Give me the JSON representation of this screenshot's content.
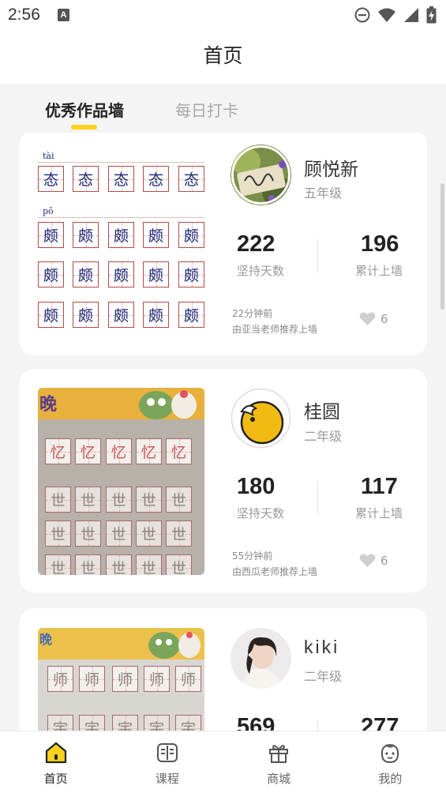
{
  "status_bar": {
    "time": "2:56",
    "notification_icon": "text-a-icon",
    "icons": [
      "dnd-icon",
      "wifi-icon",
      "cell-signal-icon",
      "battery-charging-icon"
    ]
  },
  "header": {
    "title": "首页"
  },
  "tabs": [
    {
      "label": "优秀作品墙",
      "active": true
    },
    {
      "label": "每日打卡",
      "active": false
    }
  ],
  "accent_color": "#ffd21e",
  "cards": [
    {
      "name": "顾悦新",
      "grade": "五年级",
      "stat1": {
        "value": "222",
        "label": "坚持天数"
      },
      "stat2": {
        "value": "196",
        "label": "累计上墙"
      },
      "time": "22分钟前",
      "recommend": "由亚当老师推荐上墙",
      "likes": "6",
      "work": {
        "pinyin_1": "tài",
        "char_1": "态",
        "pinyin_2": "pō",
        "char_2": "颇"
      }
    },
    {
      "name": "桂圆",
      "grade": "二年级",
      "stat1": {
        "value": "180",
        "label": "坚持天数"
      },
      "stat2": {
        "value": "117",
        "label": "累计上墙"
      },
      "time": "55分钟前",
      "recommend": "由西瓜老师推荐上墙",
      "likes": "6",
      "work": {
        "char_1": "忆",
        "char_2": "世"
      }
    },
    {
      "name": "kiki",
      "grade": "二年级",
      "stat1": {
        "value": "569"
      },
      "stat2": {
        "value": "277"
      },
      "work": {
        "char_1": "师",
        "char_2": "宇"
      }
    }
  ],
  "bottom_nav": [
    {
      "label": "首页",
      "icon": "home-icon",
      "active": true
    },
    {
      "label": "课程",
      "icon": "book-icon",
      "active": false
    },
    {
      "label": "商城",
      "icon": "gift-icon",
      "active": false
    },
    {
      "label": "我的",
      "icon": "face-icon",
      "active": false
    }
  ]
}
